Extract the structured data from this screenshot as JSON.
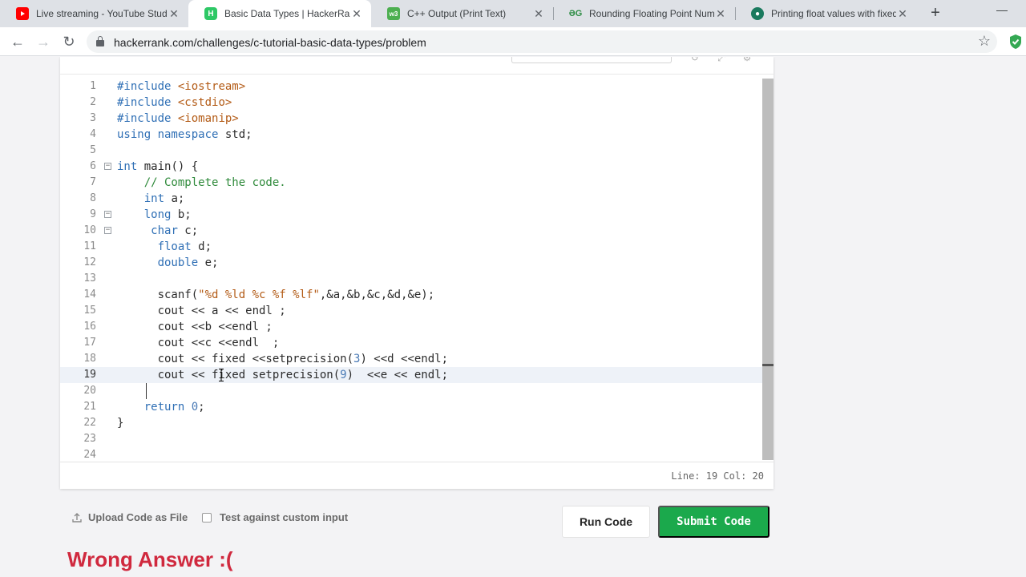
{
  "browser": {
    "tabs": [
      {
        "title": "Live streaming - YouTube Studi",
        "icon": "youtube-icon",
        "color": "#ff0000"
      },
      {
        "title": "Basic Data Types | HackerRank",
        "icon": "hackerrank-icon",
        "color": "#2ec866"
      },
      {
        "title": "C++ Output (Print Text)",
        "icon": "w3schools-icon",
        "color": "#4caf50"
      },
      {
        "title": "Rounding Floating Point Numb",
        "icon": "geeksforgeeks-icon",
        "color": "#2f8d46"
      },
      {
        "title": "Printing float values with fixed",
        "icon": "stackoverflow-icon",
        "color": "#1a7a5e"
      }
    ],
    "active_tab": 1,
    "url": "hackerrank.com/challenges/c-tutorial-basic-data-types/problem"
  },
  "editor": {
    "lines": [
      {
        "n": "1",
        "html": "<span class=\"kw\">#include</span> <span class=\"st\">&lt;iostream&gt;</span>"
      },
      {
        "n": "2",
        "html": "<span class=\"kw\">#include</span> <span class=\"st\">&lt;cstdio&gt;</span>"
      },
      {
        "n": "3",
        "html": "<span class=\"kw\">#include</span> <span class=\"st\">&lt;iomanip&gt;</span>"
      },
      {
        "n": "4",
        "html": "<span class=\"kw\">using namespace</span> std;"
      },
      {
        "n": "5",
        "html": ""
      },
      {
        "n": "6",
        "html": "<span class=\"kw\">int</span> main() {",
        "fold": true
      },
      {
        "n": "7",
        "html": "    <span class=\"cm\">// Complete the code.</span>"
      },
      {
        "n": "8",
        "html": "    <span class=\"kw\">int</span> a;"
      },
      {
        "n": "9",
        "html": "    <span class=\"kw\">long</span> b;",
        "fold": true
      },
      {
        "n": "10",
        "html": "     <span class=\"kw\">char</span> c;",
        "fold": true
      },
      {
        "n": "11",
        "html": "      <span class=\"kw\">float</span> d;"
      },
      {
        "n": "12",
        "html": "      <span class=\"kw\">double</span> e;"
      },
      {
        "n": "13",
        "html": ""
      },
      {
        "n": "14",
        "html": "      scanf(<span class=\"st\">\"%d %ld %c %f %lf\"</span>,&amp;a,&amp;b,&amp;c,&amp;d,&amp;e);"
      },
      {
        "n": "15",
        "html": "      cout &lt;&lt; a &lt;&lt; endl ;"
      },
      {
        "n": "16",
        "html": "      cout &lt;&lt;b &lt;&lt;endl ;"
      },
      {
        "n": "17",
        "html": "      cout &lt;&lt;c &lt;&lt;endl  ;"
      },
      {
        "n": "18",
        "html": "      cout &lt;&lt; fixed &lt;&lt;setprecision(<span class=\"nm\">3</span>) &lt;&lt;d &lt;&lt;endl;"
      },
      {
        "n": "19",
        "html": "      cout &lt;&lt; fixed setprecision(<span class=\"nm\">9</span>)  &lt;&lt;e &lt;&lt; endl;",
        "current": true
      },
      {
        "n": "20",
        "html": ""
      },
      {
        "n": "21",
        "html": "    <span class=\"kw\">return</span> <span class=\"nm\">0</span>;"
      },
      {
        "n": "22",
        "html": "}"
      },
      {
        "n": "23",
        "html": ""
      },
      {
        "n": "24",
        "html": ""
      }
    ],
    "status": "Line: 19 Col: 20"
  },
  "actions": {
    "upload_label": "Upload Code as File",
    "custom_input_label": "Test against custom input",
    "custom_input_checked": false,
    "run_label": "Run Code",
    "submit_label": "Submit Code"
  },
  "result": {
    "message": "Wrong Answer :("
  },
  "colors": {
    "submit_green": "#1ba94c",
    "wrong_red": "#d0293e"
  }
}
